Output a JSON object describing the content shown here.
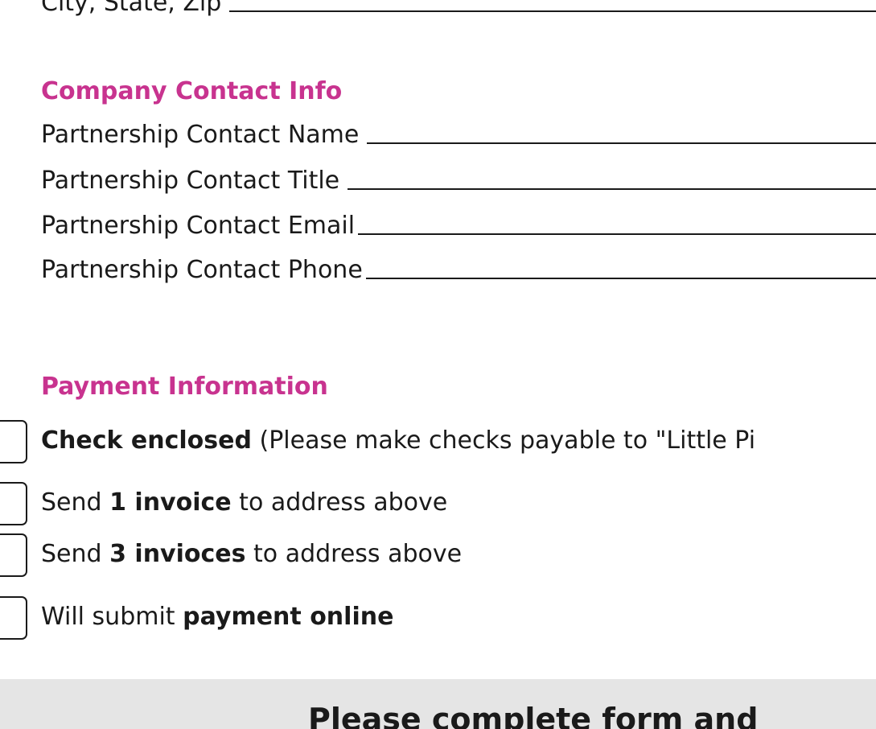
{
  "address": {
    "city_state_zip_label": "City, State, Zip"
  },
  "company_contact": {
    "heading": "Company Contact Info",
    "fields": [
      {
        "label": "Partnership Contact Name"
      },
      {
        "label": "Partnership Contact Title"
      },
      {
        "label": "Partnership Contact Email"
      },
      {
        "label": "Partnership Contact Phone"
      }
    ]
  },
  "payment": {
    "heading": "Payment Information",
    "options": [
      {
        "bold": "Check enclosed",
        "suffix": " (Please make checks payable to \"Little Pi"
      },
      {
        "prefix": "Send ",
        "bold": "1 invoice",
        "suffix": " to address above"
      },
      {
        "prefix": "Send ",
        "bold": "3 invioces",
        "suffix": " to address above"
      },
      {
        "prefix": "Will submit ",
        "bold": "payment online"
      }
    ]
  },
  "footer": {
    "text": "Please complete form and"
  }
}
